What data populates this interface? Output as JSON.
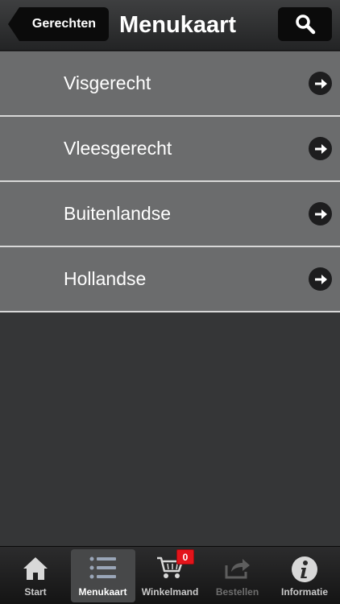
{
  "nav": {
    "back_label": "Gerechten",
    "title": "Menukaart",
    "search_icon": "search-icon"
  },
  "menu": {
    "items": [
      {
        "label": "Visgerecht"
      },
      {
        "label": "Vleesgerecht"
      },
      {
        "label": "Buitenlandse"
      },
      {
        "label": "Hollandse"
      }
    ]
  },
  "tabbar": {
    "tabs": [
      {
        "label": "Start",
        "icon": "home-icon"
      },
      {
        "label": "Menukaart",
        "icon": "list-icon",
        "active": true
      },
      {
        "label": "Winkelmand",
        "icon": "cart-icon",
        "badge": "0"
      },
      {
        "label": "Bestellen",
        "icon": "share-icon",
        "disabled": true
      },
      {
        "label": "Informatie",
        "icon": "info-icon"
      }
    ]
  },
  "colors": {
    "badge": "#e3141b",
    "row": "#6b6c6d",
    "background": "#353637"
  }
}
